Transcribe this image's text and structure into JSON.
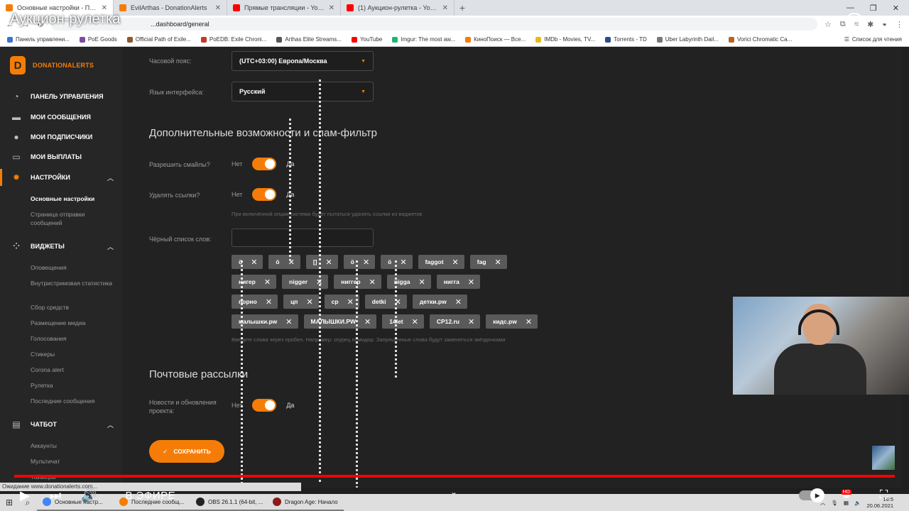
{
  "video": {
    "title": "Аукцион-рулетка",
    "live_label": "В ЭФИРЕ",
    "hd_badge": "HD"
  },
  "browser": {
    "tabs": [
      {
        "label": "Основные настройки - Панель",
        "color": "#f57d07",
        "active": true
      },
      {
        "label": "EvilArthas - DonationAlerts",
        "color": "#f57d07",
        "active": false
      },
      {
        "label": "Прямые трансляции - YouTube",
        "color": "#ff0000",
        "active": false
      },
      {
        "label": "(1) Аукцион-рулетка - YouTube",
        "color": "#ff0000",
        "active": false
      }
    ],
    "url": "...dashboard/general",
    "bookmarks": [
      {
        "label": "Панель управлени...",
        "color": "#3b73d1"
      },
      {
        "label": "PoE Goods",
        "color": "#7a4ca0"
      },
      {
        "label": "Official Path of Exile...",
        "color": "#8a5a2b"
      },
      {
        "label": "PoEDB: Exile Chroni...",
        "color": "#c23b22"
      },
      {
        "label": "Arthas Elite Streams...",
        "color": "#555555"
      },
      {
        "label": "YouTube",
        "color": "#ff0000"
      },
      {
        "label": "Imgur: The most aw...",
        "color": "#1bb76e"
      },
      {
        "label": "КиноПоиск — Все...",
        "color": "#f57d07"
      },
      {
        "label": "IMDb - Movies, TV...",
        "color": "#e6b91e"
      },
      {
        "label": "Torrents - TD",
        "color": "#2b4d8a"
      },
      {
        "label": "Uber Labyrinth Dail...",
        "color": "#777777"
      },
      {
        "label": "Vorici Chromatic Ca...",
        "color": "#b5651d"
      }
    ],
    "reading_list": "Список для чтения",
    "status": "Ожидание www.donationalerts.com..."
  },
  "sidebar": {
    "logo_text": "DONATIONALERTS",
    "nav": [
      {
        "label": "ПАНЕЛЬ УПРАВЛЕНИЯ",
        "icon": "gauge-icon"
      },
      {
        "label": "МОИ СООБЩЕНИЯ",
        "icon": "chat-icon"
      },
      {
        "label": "МОИ ПОДПИСЧИКИ",
        "icon": "user-icon"
      },
      {
        "label": "МОИ ВЫПЛАТЫ",
        "icon": "card-icon"
      },
      {
        "label": "НАСТРОЙКИ",
        "icon": "gear-icon"
      },
      {
        "label": "ВИДЖЕТЫ",
        "icon": "widgets-icon"
      },
      {
        "label": "ЧАТБОТ",
        "icon": "bot-icon"
      }
    ],
    "settings_sub": [
      "Основные настройки",
      "Страница отправки сообщений"
    ],
    "widgets_sub": [
      "Оповещения",
      "Внутристримовая статистика",
      "Сбор средств",
      "Размещение медиа",
      "Голосования",
      "Стикеры",
      "Corona alert",
      "Рулетка",
      "Последние сообщения"
    ],
    "chatbot_sub": [
      "Аккаунты",
      "Мультичат",
      "Таймеры"
    ]
  },
  "main": {
    "timezone_label": "Часовой пояс:",
    "timezone_value": "(UTC+03:00) Европа/Москва",
    "language_label": "Язык интерфейса:",
    "language_value": "Русский",
    "section_extra": "Дополнительные возможности и спам-фильтр",
    "smiles_label": "Разрешить смайлы?",
    "links_label": "Удалять ссылки?",
    "no": "Нет",
    "yes": "Да",
    "links_hint": "При включённой опции система будет пытаться удалять ссылки из виджетов",
    "blacklist_label": "Чёрный список слов:",
    "tag_rows": [
      [
        "ö",
        "ö",
        "[]",
        "ö",
        "ö",
        "faggot",
        "fag"
      ],
      [
        "нигер",
        "nigger",
        "ниггер",
        "nigga",
        "нигга"
      ],
      [
        "порно",
        "цп",
        "cp",
        "detki",
        "детки.pw"
      ],
      [
        "малышки.pw",
        "МАЛЫШКИ.PW",
        "14let",
        "CP12.ru",
        "кидс.pw"
      ]
    ],
    "blacklist_hint": "Введите слова через пробел. Например: огурец помидор. Запрещённые слова будут заменяться звёздочками",
    "section_mail": "Почтовые рассылки",
    "news_label": "Новости и обновления проекта:",
    "save_label": "СОХРАНИТЬ"
  },
  "taskbar": {
    "items": [
      {
        "label": "Основные настр...",
        "color": "#4285f4"
      },
      {
        "label": "Последние сообщ...",
        "color": "#f57d07"
      },
      {
        "label": "OBS 26.1.1 (64-bit, ...",
        "color": "#222222"
      },
      {
        "label": "Dragon Age: Начало",
        "color": "#8b1a1a"
      }
    ],
    "time": "16:5",
    "date": "20.06.2021"
  }
}
